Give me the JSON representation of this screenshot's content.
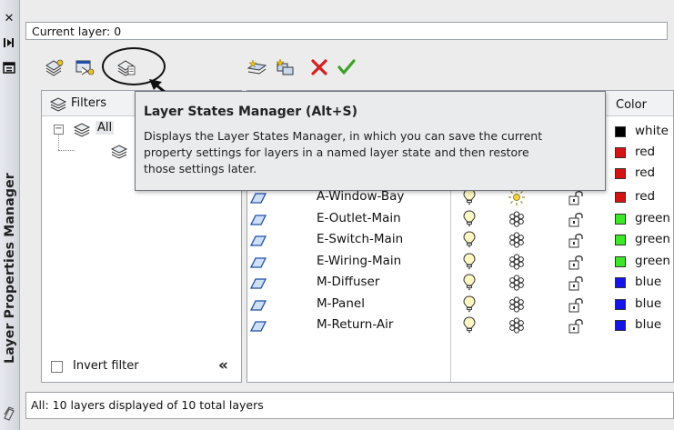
{
  "palette": {
    "title": "Layer Properties Manager"
  },
  "header": {
    "current_layer": "Current layer: 0"
  },
  "filters": {
    "heading": "Filters",
    "tree_all": "All",
    "invert_label": "Invert filter"
  },
  "grid": {
    "color_header": "Color",
    "hidden_row_color": "white",
    "layers": [
      {
        "name": "A-Window-Bay",
        "color_name": "red",
        "color": "#d41414",
        "frozen": false
      },
      {
        "name": "E-Outlet-Main",
        "color_name": "green",
        "color": "#3ee62a",
        "frozen": true
      },
      {
        "name": "E-Switch-Main",
        "color_name": "green",
        "color": "#3ee62a",
        "frozen": true
      },
      {
        "name": "E-Wiring-Main",
        "color_name": "green",
        "color": "#3ee62a",
        "frozen": true
      },
      {
        "name": "M-Diffuser",
        "color_name": "blue",
        "color": "#1414e6",
        "frozen": true
      },
      {
        "name": "M-Panel",
        "color_name": "blue",
        "color": "#1414e6",
        "frozen": true
      },
      {
        "name": "M-Return-Air",
        "color_name": "blue",
        "color": "#1414e6",
        "frozen": true
      }
    ],
    "partial_colors": [
      {
        "color_name": "white",
        "color": "#000000"
      },
      {
        "color_name": "red",
        "color": "#d41414"
      },
      {
        "color_name": "red",
        "color": "#d41414"
      }
    ]
  },
  "tooltip": {
    "title": "Layer States Manager (Alt+S)",
    "body": "Displays the Layer States Manager, in which you can save the current\nproperty settings for layers in a named layer state and then restore\nthose settings later."
  },
  "status": {
    "text": "All: 10 layers displayed of 10 total layers"
  }
}
